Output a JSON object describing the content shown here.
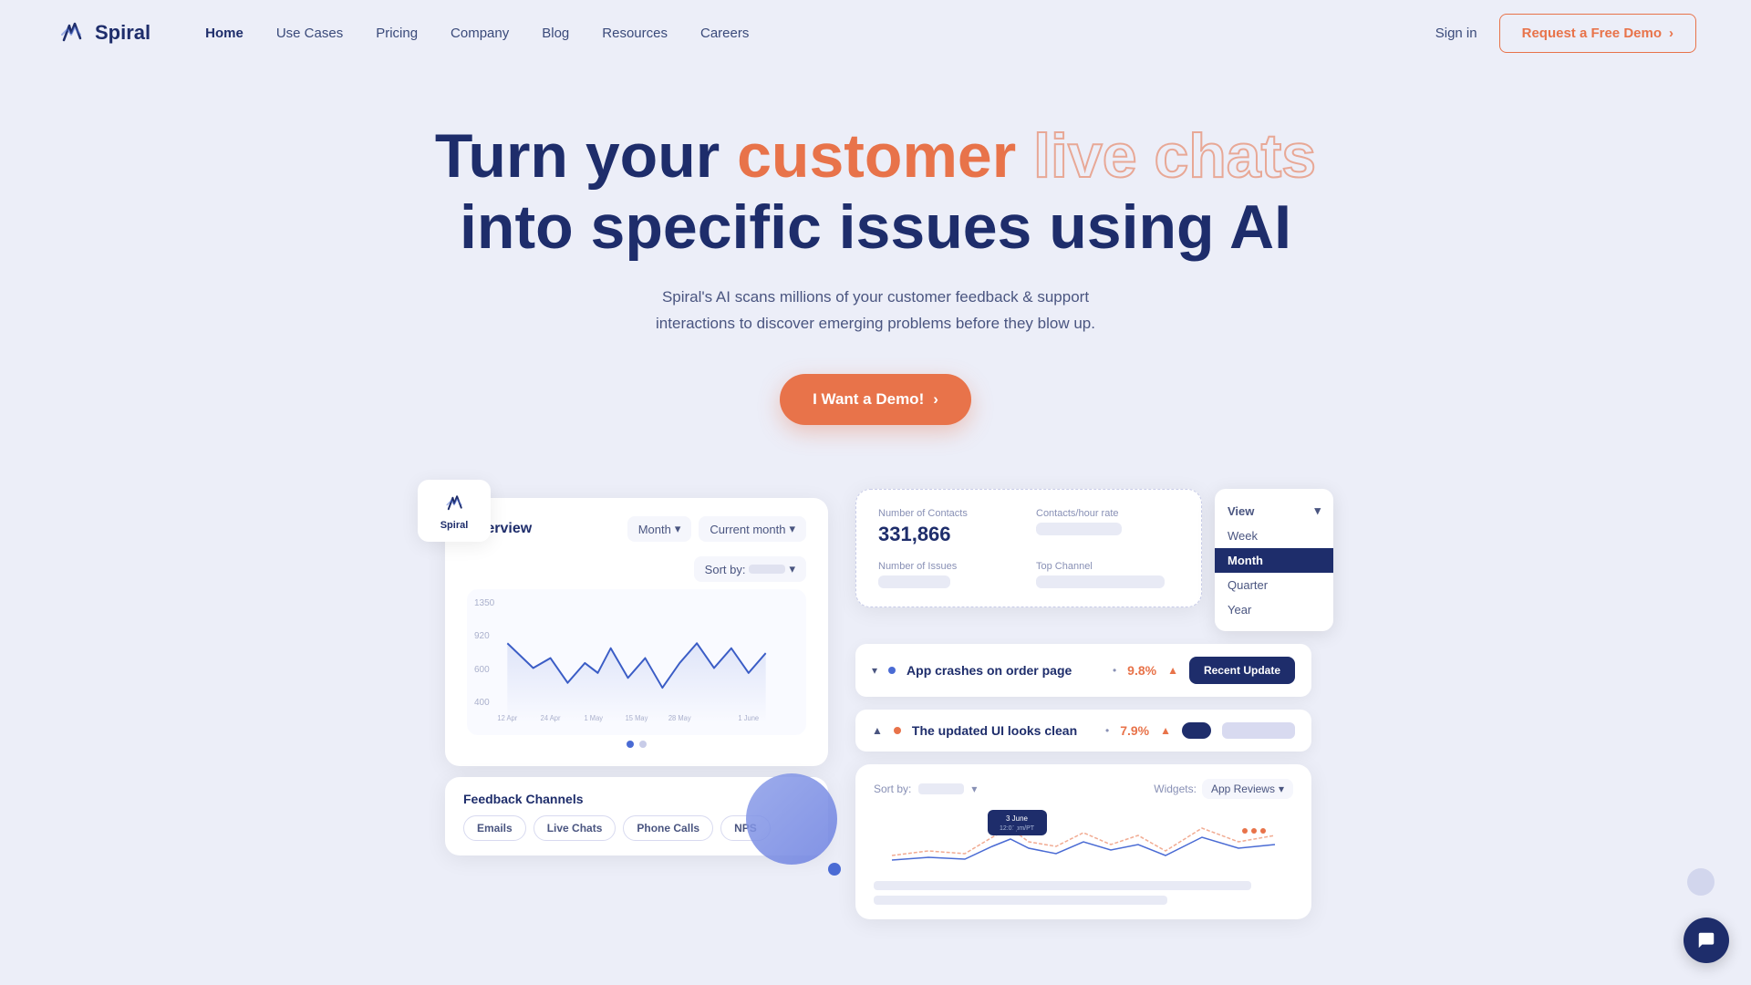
{
  "nav": {
    "logo_text": "Spiral",
    "links": [
      {
        "label": "Home",
        "active": true
      },
      {
        "label": "Use Cases",
        "active": false
      },
      {
        "label": "Pricing",
        "active": false
      },
      {
        "label": "Company",
        "active": false
      },
      {
        "label": "Blog",
        "active": false
      },
      {
        "label": "Resources",
        "active": false
      },
      {
        "label": "Careers",
        "active": false
      }
    ],
    "sign_in": "Sign in",
    "demo_btn": "Request a Free Demo"
  },
  "hero": {
    "title_part1": "Turn your",
    "title_customer": "customer",
    "title_live_chats": "live chats",
    "title_line2": "into specific issues using AI",
    "subtitle": "Spiral's AI scans millions of your customer feedback & support interactions to discover emerging problems before they blow up.",
    "cta": "I Want a Demo!"
  },
  "dashboard": {
    "spiral_badge": "Spiral",
    "overview": {
      "title": "Overview",
      "month_btn": "Month",
      "current_month_btn": "Current month",
      "sort_by": "Sort by:",
      "y_axis": [
        "1350",
        "920",
        "600",
        "400"
      ]
    },
    "stats": {
      "contacts_label": "Number of Contacts",
      "contacts_value": "331,866",
      "hour_rate_label": "Contacts/hour rate",
      "issues_label": "Number of Issues",
      "top_channel_label": "Top Channel"
    },
    "view_options": {
      "title": "View",
      "options": [
        "Week",
        "Month",
        "Quarter",
        "Year"
      ],
      "active": "Month"
    },
    "issues": [
      {
        "name": "App crashes on order page",
        "pct": "9.8%",
        "btn": "Recent Update",
        "collapsed": true
      },
      {
        "name": "The updated UI looks clean",
        "pct": "7.9%",
        "collapsed": false
      }
    ],
    "feedback": {
      "title": "Feedback Channels",
      "tags": [
        "Emails",
        "Live Chats",
        "Phone Calls",
        "NPS"
      ]
    },
    "detail": {
      "sort_by": "Sort by:",
      "widgets_label": "Widgets:",
      "app_reviews": "App Reviews",
      "tooltip_date": "3 June",
      "tooltip_time": "12:01pm/PT"
    }
  },
  "chat_icon": "💬"
}
